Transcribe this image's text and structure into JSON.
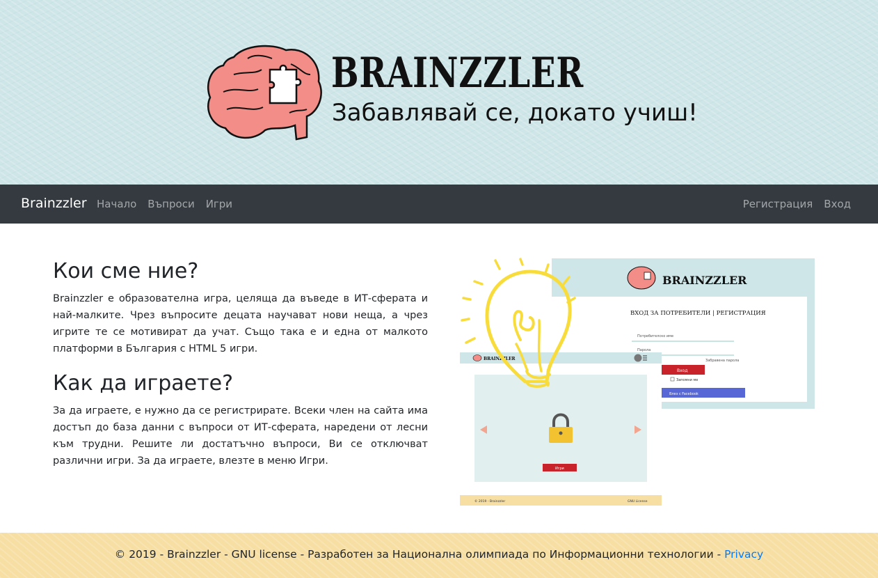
{
  "header": {
    "title": "BRAINZZLER",
    "tagline": "Забавлявай се, докато учиш!"
  },
  "navbar": {
    "brand": "Brainzzler",
    "left_items": [
      "Начало",
      "Въпроси",
      "Игри"
    ],
    "right_items": [
      "Регистрация",
      "Вход"
    ]
  },
  "main": {
    "about_title": "Кои сме ние?",
    "about_text": "Brainzzler е образователна игра, целяща да въведе в ИТ-сферата и най-малките. Чрез въпросите децата научават нови неща, а чрез игрите те се мотивират да учат. Също така е и една от малкото платформи в България с HTML 5 игри.",
    "howto_title": "Как да играете?",
    "howto_text": "За да играете, е нужно да се регистрирате. Всеки член на сайта има достъп до база данни с въпроси от ИТ-сферата, наредени от лесни към трудни. Решите ли достатъчно въпроси, Ви се отключват различни игри. За да играете, влезте в меню Игри."
  },
  "illustration": {
    "mock_brand": "BRAINZZLER",
    "login_heading": "ВХОД ЗА ПОТРЕБИТЕЛИ | РЕГИСТРАЦИЯ",
    "username_label": "Потребителско име",
    "password_label": "Парола",
    "forgot_label": "Забравена парола",
    "login_button": "Вход",
    "remember_label": "Запомни ме",
    "facebook_button": "Влез с Facebook",
    "games_button": "Игри",
    "mock_footer_left": "© 2019 - Brainzzler",
    "mock_footer_right": "GNU License"
  },
  "footer": {
    "text": "© 2019 - Brainzzler - GNU license - Разработен за Национална олимпиада по Информационни технологии - ",
    "privacy_link": "Privacy"
  },
  "colors": {
    "banner_bg": "#cfe6e8",
    "navbar_bg": "#343a40",
    "footer_bg": "#f7dfa4",
    "brain_pink": "#f28d87",
    "link_blue": "#007bff",
    "bulb_yellow": "#f7dc3c",
    "button_red": "#c8232a",
    "facebook_blue": "#5768d6"
  }
}
